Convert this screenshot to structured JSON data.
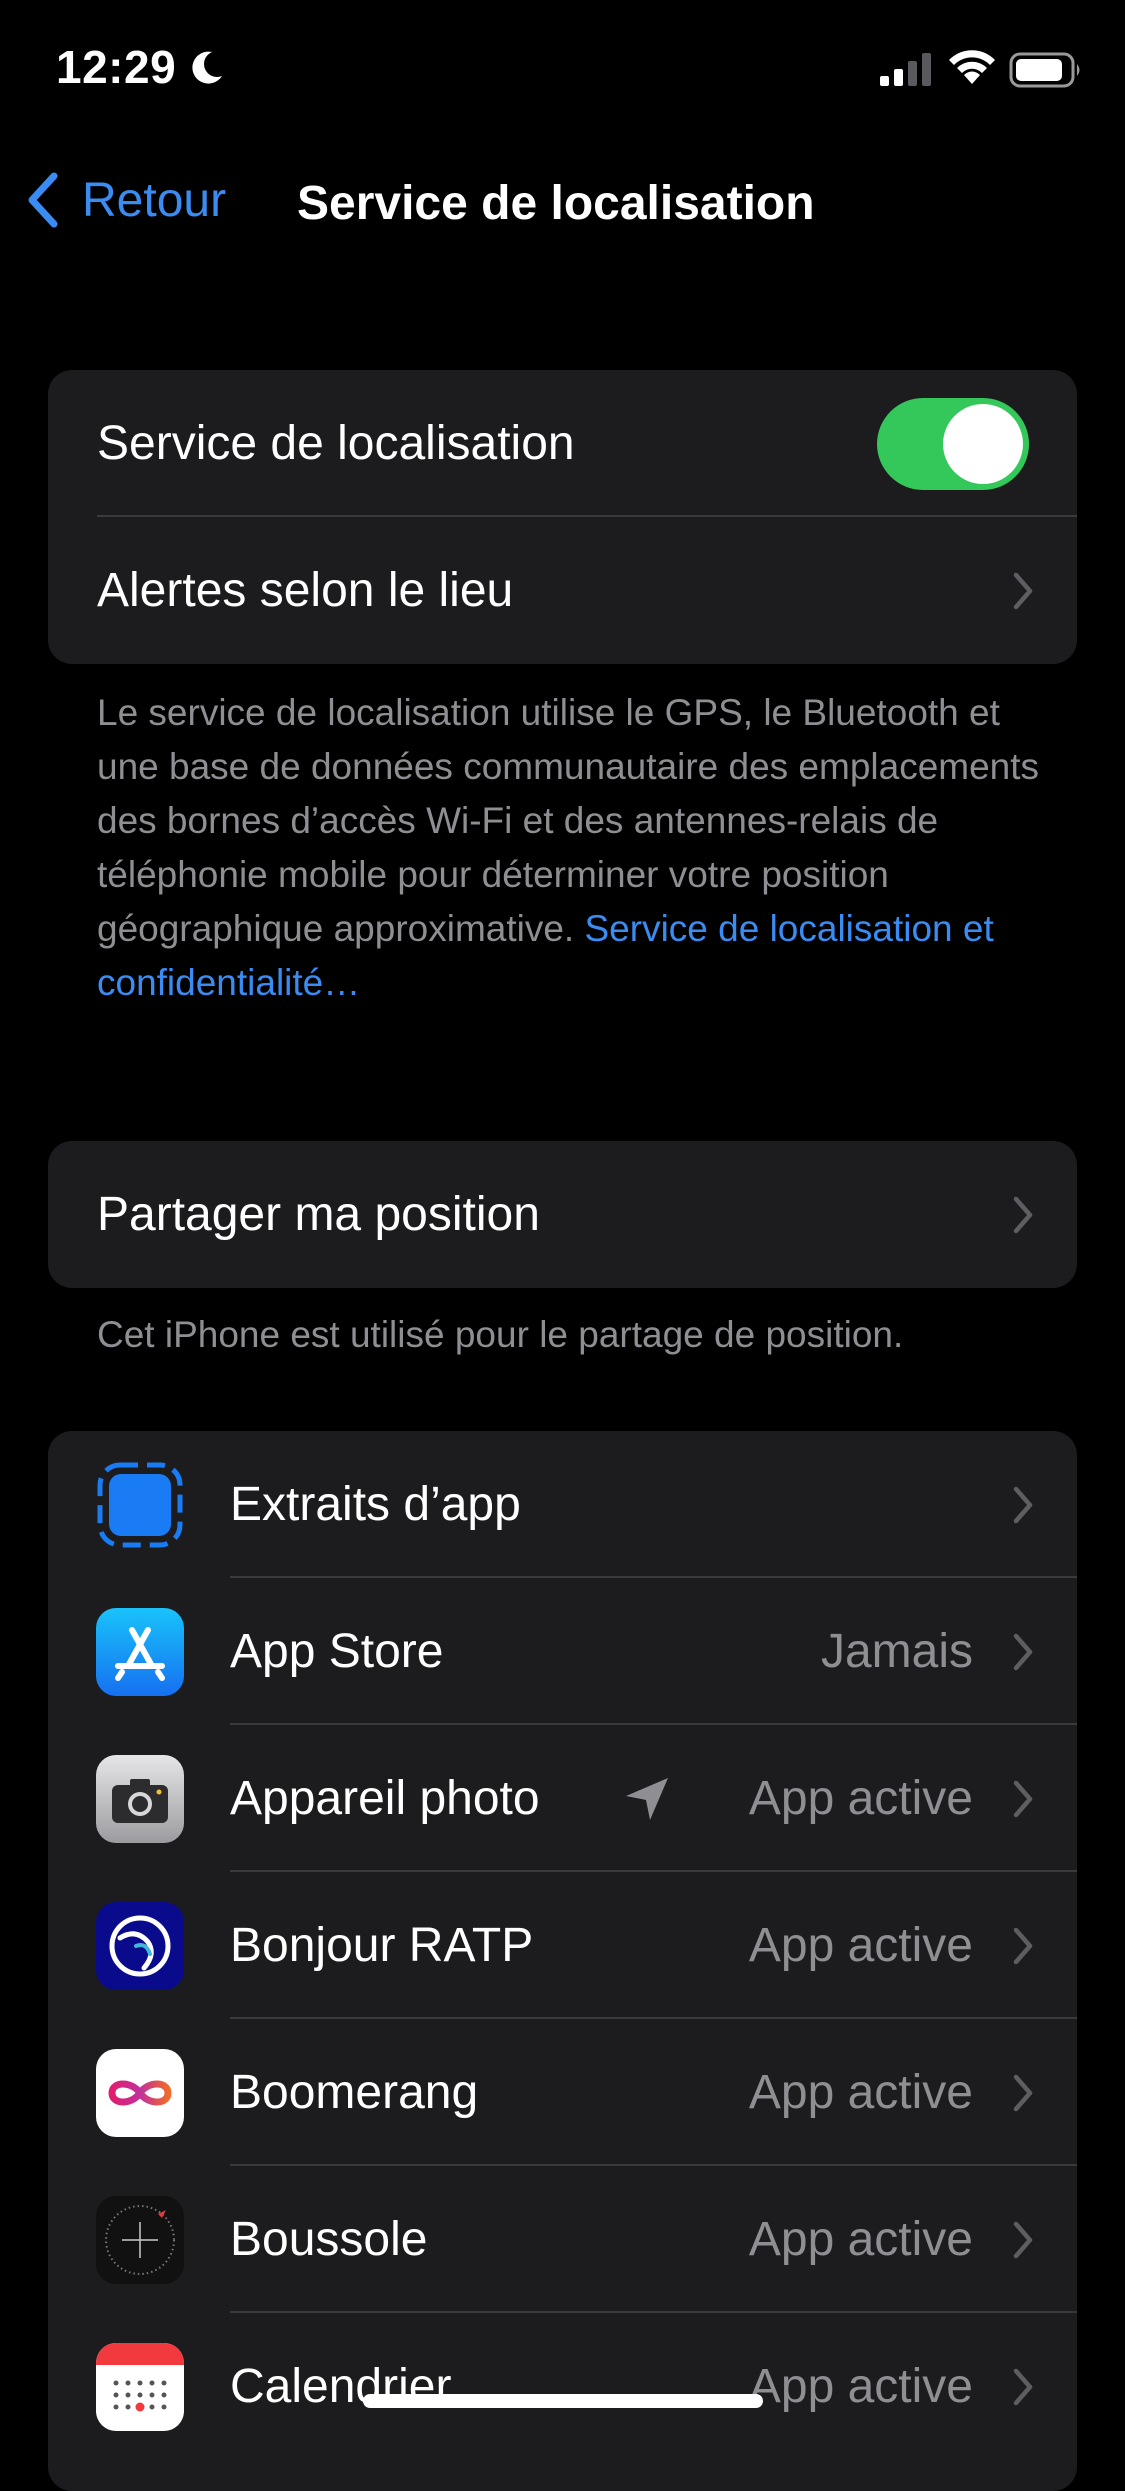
{
  "status_bar": {
    "time": "12:29",
    "icons": [
      "moon-icon",
      "signal-icon",
      "wifi-icon",
      "battery-icon"
    ]
  },
  "nav": {
    "back_label": "Retour",
    "title": "Service de localisation"
  },
  "colors": {
    "accent": "#3a8cf2",
    "toggle_on": "#34c759",
    "card_bg": "#1c1c1e",
    "secondary_text": "#8e8e93"
  },
  "main_section": {
    "location_services_label": "Service de localisation",
    "location_services_enabled": true,
    "location_alerts_label": "Alertes selon le lieu",
    "description": "Le service de localisation utilise le GPS, le Bluetooth et une base de données communautaire des emplacements des bornes d’accès Wi-Fi et des antennes-relais de téléphonie mobile pour déterminer votre position géographique approximative. ",
    "privacy_link": "Service de localisation et confidentialité…"
  },
  "share_section": {
    "share_label": "Partager ma position",
    "footer": "Cet iPhone est utilisé pour le partage de position."
  },
  "apps": [
    {
      "name": "Extraits d’app",
      "value": "",
      "icon": "app-clips-icon"
    },
    {
      "name": "App Store",
      "value": "Jamais",
      "icon": "app-store-icon"
    },
    {
      "name": "Appareil photo",
      "value": "App active",
      "icon": "camera-icon",
      "recent_use": true
    },
    {
      "name": "Bonjour RATP",
      "value": "App active",
      "icon": "ratp-icon"
    },
    {
      "name": "Boomerang",
      "value": "App active",
      "icon": "boomerang-icon"
    },
    {
      "name": "Boussole",
      "value": "App active",
      "icon": "compass-icon"
    },
    {
      "name": "Calendrier",
      "value": "App active",
      "icon": "calendar-icon"
    }
  ]
}
